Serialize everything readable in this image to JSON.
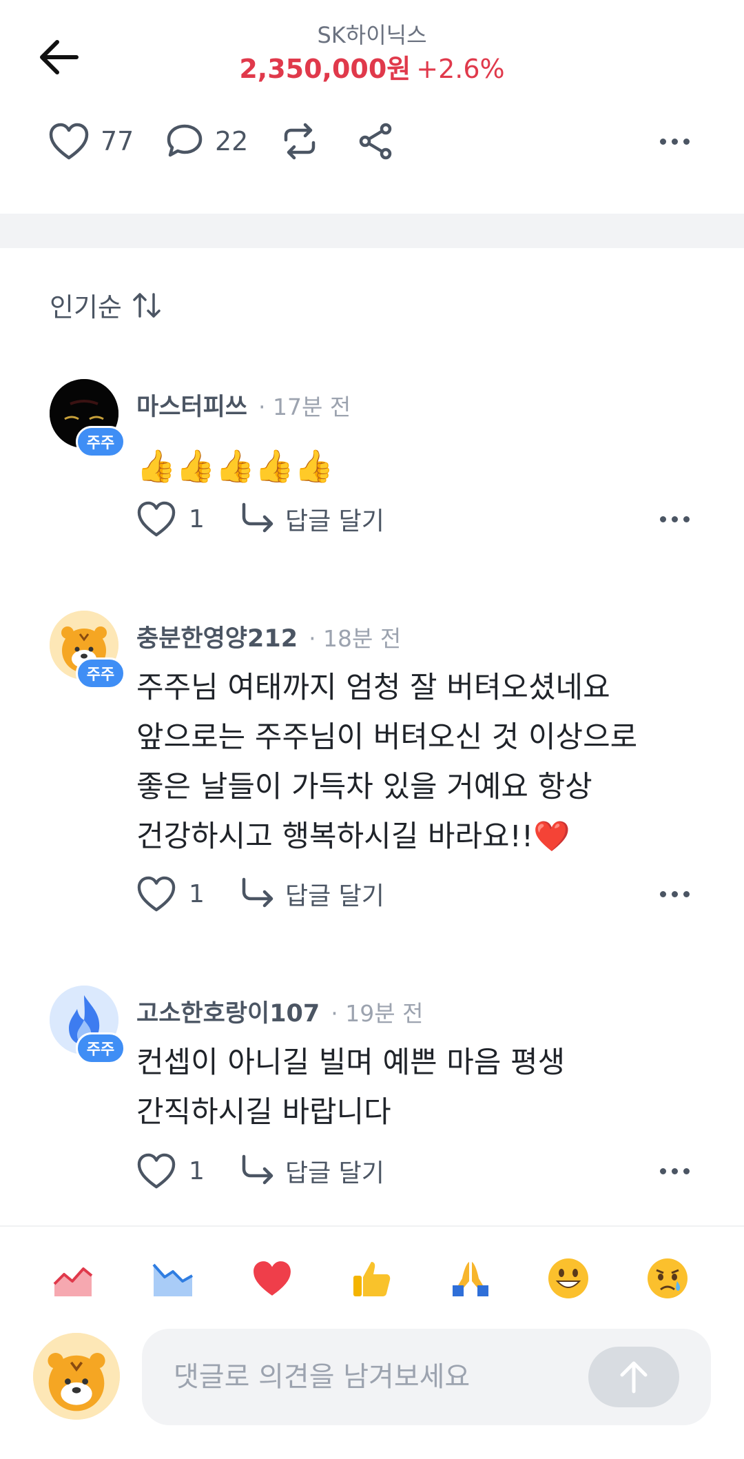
{
  "header": {
    "stock_name": "SK하이닉스",
    "price": "2,350,000원",
    "change": "+2.6%",
    "price_color": "#e0394b"
  },
  "post_actions": {
    "likes": "77",
    "comments": "22"
  },
  "sort": {
    "label": "인기순"
  },
  "comments": [
    {
      "username": "마스터피쓰",
      "time": "· 17분 전",
      "badge": "주주",
      "text": "👍👍👍👍👍",
      "likes": "1",
      "reply_label": "답글 달기"
    },
    {
      "username": "충분한영양212",
      "time": "· 18분 전",
      "badge": "주주",
      "lines": [
        "주주님 여태까지 엄청 잘 버텨오셨네요",
        "앞으로는 주주님이 버텨오신 것 이상으로",
        "좋은 날들이 가득차 있을 거예요 항상",
        "건강하시고 행복하시길 바라요!!❤️"
      ],
      "likes": "1",
      "reply_label": "답글 달기"
    },
    {
      "username": "고소한호랑이107",
      "time": "· 19분 전",
      "badge": "주주",
      "lines": [
        "컨셉이 아니길 빌며 예쁜 마음 평생",
        "간직하시길 바랍니다"
      ],
      "likes": "1",
      "reply_label": "답글 달기"
    }
  ],
  "reactions": [
    "chart-up-icon",
    "chart-down-icon",
    "heart-icon",
    "thumbs-up-icon",
    "pray-icon",
    "smile-icon",
    "tearful-icon"
  ],
  "input": {
    "placeholder": "댓글로 의견을 남겨보세요"
  },
  "colors": {
    "badge": "#3f8ef5",
    "heart": "#ef3e4a"
  }
}
